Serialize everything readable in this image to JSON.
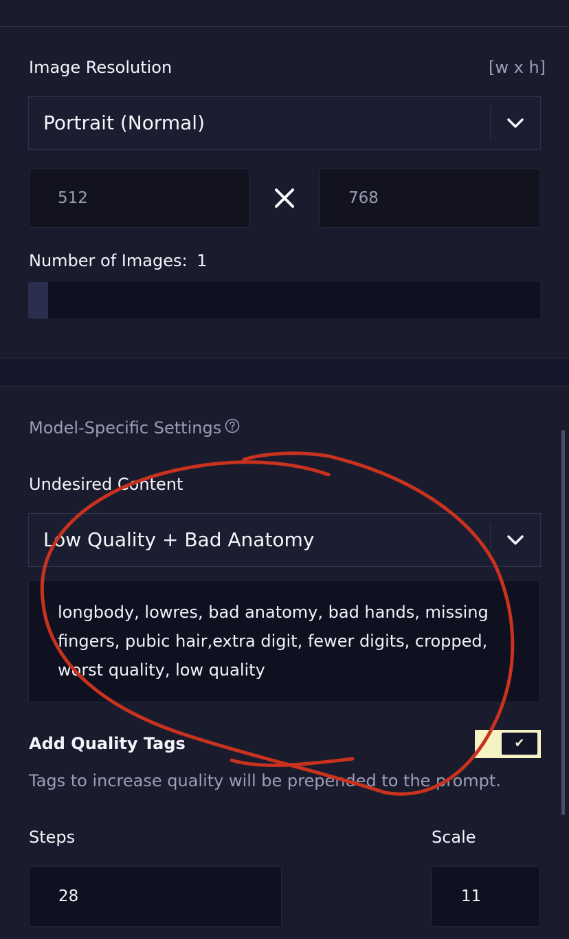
{
  "resolution": {
    "label": "Image Resolution",
    "hint": "[w x h]",
    "preset": "Portrait (Normal)",
    "width": "512",
    "height": "768",
    "times_icon": "close-icon"
  },
  "images": {
    "label": "Number of Images:",
    "count": "1",
    "slider_fraction": 0.0
  },
  "model_settings": {
    "title": "Model-Specific Settings",
    "help_icon": "question-circle-icon"
  },
  "undesired": {
    "label": "Undesired Content",
    "preset": "Low Quality + Bad Anatomy",
    "text": "longbody, lowres, bad anatomy, bad hands, missing fingers, pubic hair,extra digit, fewer digits, cropped, worst quality, low quality"
  },
  "quality_tags": {
    "label": "Add Quality Tags",
    "description": "Tags to increase quality will be prepended to the prompt.",
    "enabled": true,
    "check_glyph": "✔"
  },
  "steps": {
    "label": "Steps",
    "value": "28"
  },
  "scale": {
    "label": "Scale",
    "value": "11"
  },
  "colors": {
    "background": "#1a1c2e",
    "field": "#12131f",
    "toggle_on": "#f5f3c4",
    "annotation": "#c8321e"
  }
}
